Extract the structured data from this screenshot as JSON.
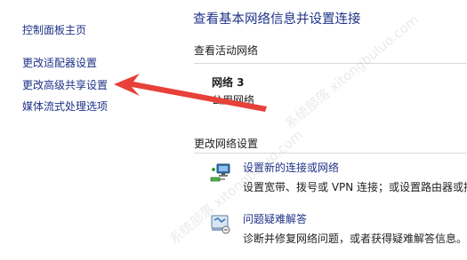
{
  "sidebar": {
    "items": [
      {
        "label": "控制面板主页"
      },
      {
        "label": "更改适配器设置"
      },
      {
        "label": "更改高级共享设置"
      },
      {
        "label": "媒体流式处理选项"
      }
    ]
  },
  "main": {
    "title": "查看基本网络信息并设置连接",
    "active_networks": {
      "heading": "查看活动网络",
      "network_name": "网络 3",
      "network_type": "公用网络"
    },
    "change_settings": {
      "heading": "更改网络设置",
      "tasks": [
        {
          "link": "设置新的连接或网络",
          "desc": "设置宽带、拨号或 VPN 连接；或设置路由器或接",
          "icon": "network-setup-icon"
        },
        {
          "link": "问题疑难解答",
          "desc": "诊断并修复网络问题，或者获得疑难解答信息。",
          "icon": "troubleshoot-icon"
        }
      ]
    }
  },
  "annotation": {
    "arrow_color": "#e8403a"
  },
  "colors": {
    "link": "#1e3287",
    "text": "#1e1e1e"
  },
  "watermark": "系统部落 xitongbuluo.com"
}
